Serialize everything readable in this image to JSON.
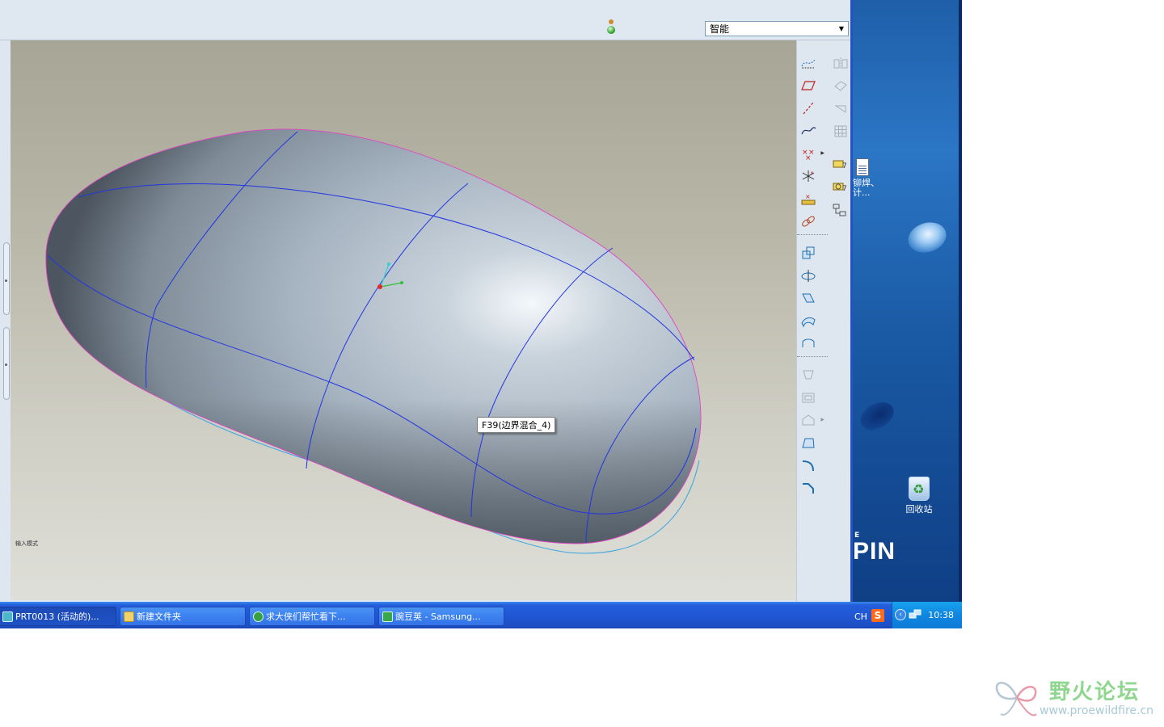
{
  "app": {
    "filter_value": "智能",
    "tooltip": "F39(边界混合_4)",
    "mode_label": "输入模式"
  },
  "desktop": {
    "doc_icon_label": "铆焊、\n计...",
    "recycle_label": "回收站",
    "logo_text": "PIN",
    "logo_small": "E"
  },
  "taskbar": {
    "buttons": [
      {
        "label": "PRT0013 (活动的)...",
        "icon": "proe-window-icon"
      },
      {
        "label": "新建文件夹",
        "icon": "folder-icon"
      },
      {
        "label": "求大侠们帮忙看下...",
        "icon": "browser-icon"
      },
      {
        "label": "豌豆荚 - Samsung...",
        "icon": "wandoujia-icon"
      }
    ],
    "lang": "CH",
    "clock": "10:38"
  },
  "watermark": {
    "title": "野火论坛",
    "url": "www.proewildfire.cn"
  },
  "colors": {
    "taskbar_blue": "#245edb",
    "tray_blue": "#0f86e0",
    "surface_gray": "#a9b6c4",
    "curve_blue": "#2030e0",
    "edge_magenta": "#e040c0",
    "edge_cyan": "#30a0e0"
  }
}
